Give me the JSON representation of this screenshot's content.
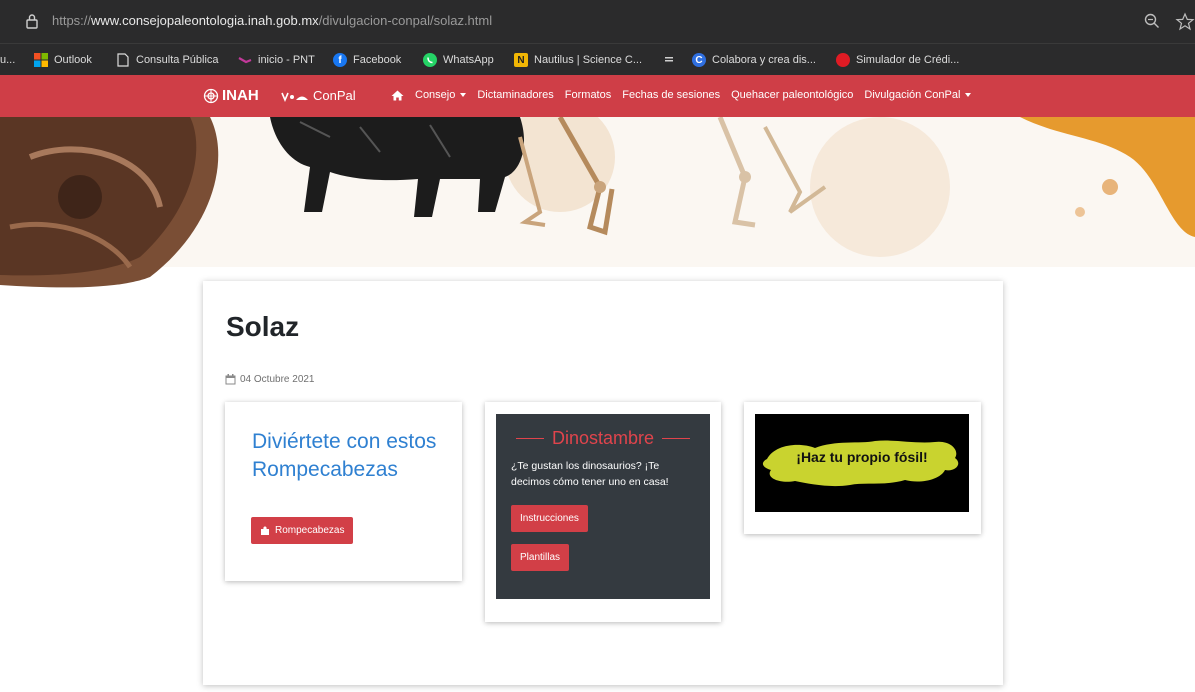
{
  "browser": {
    "url_prefix": "https://",
    "url_host": "www.consejopaleontologia.inah.gob.mx",
    "url_path": "/divulgacion-conpal/solaz.html",
    "bookmarks": [
      {
        "label": "u..."
      },
      {
        "label": "Outlook",
        "icon": "outlook-icon",
        "color": "#f25022"
      },
      {
        "label": "Consulta Pública",
        "icon": "page-icon",
        "color": "#dcdcdc"
      },
      {
        "label": "inicio - PNT",
        "icon": "pnt-icon",
        "color": "#c2399a"
      },
      {
        "label": "Facebook",
        "icon": "facebook-icon",
        "color": "#1877f2"
      },
      {
        "label": "WhatsApp",
        "icon": "whatsapp-icon",
        "color": "#25d366"
      },
      {
        "label": "Nautilus | Science C...",
        "icon": "nautilus-icon",
        "color": "#f2b705"
      },
      {
        "label": "",
        "icon": "menu-icon",
        "color": "#cfcfcf"
      },
      {
        "label": "Colabora y crea dis...",
        "icon": "colabora-icon",
        "color": "#2f6fe0"
      },
      {
        "label": "Simulador de Crédi...",
        "icon": "simulador-icon",
        "color": "#e01b24"
      }
    ]
  },
  "navbar": {
    "brand": "INAH",
    "brand2": "ConPal",
    "links": [
      {
        "label": "Consejo",
        "dropdown": true
      },
      {
        "label": "Dictaminadores",
        "dropdown": false
      },
      {
        "label": "Formatos",
        "dropdown": false
      },
      {
        "label": "Fechas de sesiones",
        "dropdown": false
      },
      {
        "label": "Quehacer paleontológico",
        "dropdown": false
      },
      {
        "label": "Divulgación ConPal",
        "dropdown": true
      }
    ],
    "color": "#cf3e47"
  },
  "page": {
    "title": "Solaz",
    "date": "04 Octubre 2021"
  },
  "cards": {
    "puzzle": {
      "title": "Diviértete con estos Rompecabezas",
      "button": "Rompecabezas"
    },
    "dino": {
      "heading": "Dinostambre",
      "text": "¿Te gustan los dinosaurios? ¡Te decimos cómo tener uno en casa!",
      "button1": "Instrucciones",
      "button2": "Plantillas"
    },
    "fossil": {
      "label": "¡Haz tu propio fósil!"
    }
  },
  "colors": {
    "accent_red": "#d23f47",
    "link_blue": "#2f80d1",
    "dark_panel": "#343a40",
    "fossil_yellow": "#c9d32f"
  }
}
